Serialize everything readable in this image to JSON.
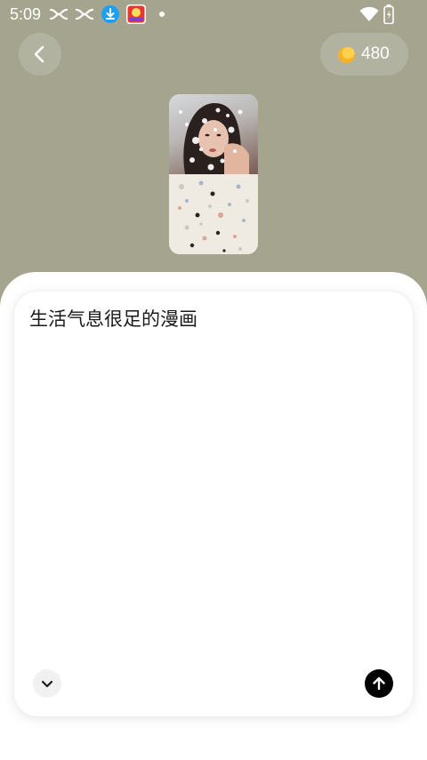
{
  "status_bar": {
    "time": "5:09",
    "icons": [
      "notification-icon",
      "notification-icon",
      "download-icon",
      "app-icon",
      "wifi-icon",
      "battery-icon"
    ]
  },
  "header": {
    "back_icon": "chevron-left-icon",
    "coin_balance": "480",
    "coin_icon": "coin-icon"
  },
  "prompt": {
    "text": "生活气息很足的漫画"
  },
  "controls": {
    "collapse_icon": "chevron-down-icon",
    "send_icon": "arrow-up-icon"
  },
  "colors": {
    "background": "#a4a48f",
    "sheet": "#ffffff",
    "send_button": "#000000",
    "coin": "#f5b228"
  }
}
